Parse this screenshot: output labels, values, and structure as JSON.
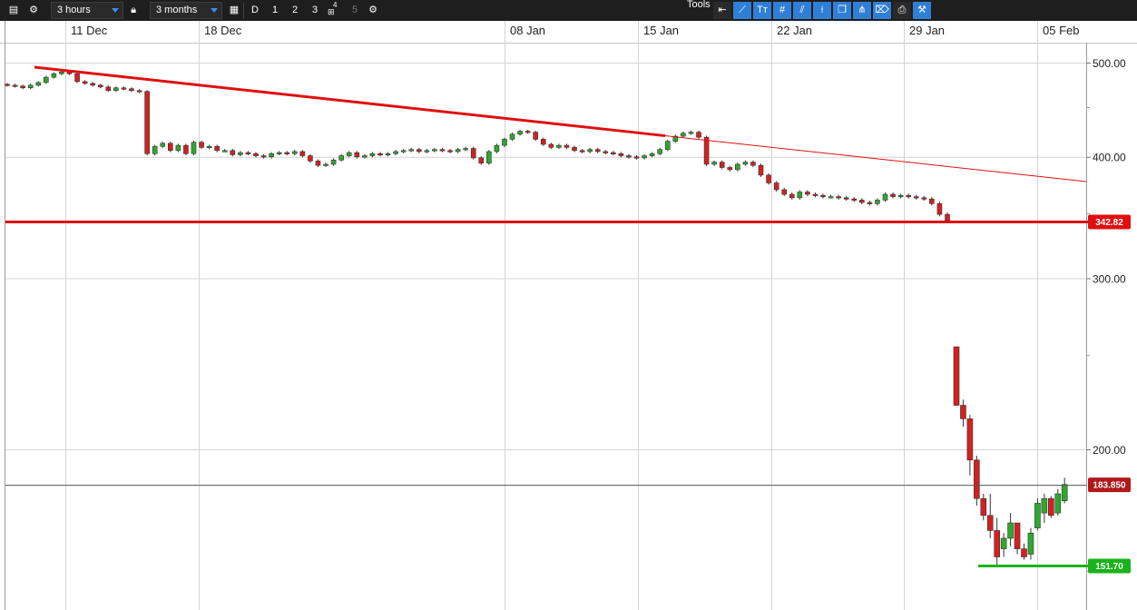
{
  "toolbar": {
    "interval": "3 hours",
    "range": "3 months",
    "period_buttons": [
      "D",
      "1",
      "2",
      "3",
      "4",
      "5"
    ],
    "tools_label": "Tools"
  },
  "colors": {
    "up": "#2ea82e",
    "down": "#d42020",
    "trendline": "#e01010",
    "support": "#1bb31b",
    "current_price_badge": "#b01818",
    "grid": "#d4d4d4",
    "tool_active": "#2f7fd6"
  },
  "chart_data": {
    "type": "candlestick",
    "xlabel": "",
    "ylabel": "",
    "x_ticks": [
      "11 Dec",
      "18 Dec",
      "08 Jan",
      "15 Jan",
      "22 Jan",
      "29 Jan",
      "05 Feb"
    ],
    "y_ticks": [
      500,
      400,
      300,
      200
    ],
    "y_tick_labels": [
      "500.00",
      "400.00",
      "300.00",
      "200.00"
    ],
    "y_scale": "log",
    "y_range": [
      138,
      530
    ],
    "grid": true,
    "closes": [
      474,
      473,
      471,
      474,
      477,
      483,
      487,
      489,
      487,
      478,
      476,
      474,
      472,
      468,
      471,
      470,
      468,
      467,
      403,
      410,
      413,
      406,
      411,
      403,
      414,
      409,
      410,
      406,
      406,
      402,
      404,
      403,
      401,
      400,
      403,
      404,
      403,
      405,
      401,
      396,
      392,
      393,
      397,
      401,
      404,
      400,
      401,
      403,
      402,
      403,
      405,
      406,
      407,
      405,
      406,
      407,
      406,
      405,
      407,
      408,
      399,
      394,
      405,
      411,
      417,
      422,
      425,
      424,
      417,
      412,
      409,
      411,
      409,
      406,
      405,
      407,
      405,
      404,
      403,
      401,
      400,
      399,
      401,
      403,
      407,
      415,
      420,
      423,
      424,
      419,
      393,
      395,
      390,
      388,
      393,
      395,
      392,
      383,
      376,
      370,
      366,
      363,
      368,
      366,
      365,
      364,
      364,
      363,
      362,
      361,
      359,
      358,
      361,
      366,
      364,
      365,
      364,
      363,
      362,
      358,
      349,
      344
    ],
    "tail_candles": [
      {
        "open": 255,
        "high": 255,
        "low": 222,
        "close": 222
      },
      {
        "open": 222,
        "high": 225,
        "low": 211,
        "close": 215
      },
      {
        "open": 215,
        "high": 217,
        "low": 188,
        "close": 195
      },
      {
        "open": 195,
        "high": 197,
        "low": 175,
        "close": 178
      },
      {
        "open": 178,
        "high": 180,
        "low": 169,
        "close": 171
      },
      {
        "open": 171,
        "high": 180,
        "low": 162,
        "close": 165
      },
      {
        "open": 165,
        "high": 170,
        "low": 151.7,
        "close": 155
      },
      {
        "open": 158,
        "high": 164,
        "low": 155,
        "close": 162
      },
      {
        "open": 162,
        "high": 172,
        "low": 159,
        "close": 168
      },
      {
        "open": 168,
        "high": 168,
        "low": 156,
        "close": 158
      },
      {
        "open": 158,
        "high": 160,
        "low": 154,
        "close": 155
      },
      {
        "open": 156,
        "high": 166,
        "low": 154,
        "close": 164
      },
      {
        "open": 166,
        "high": 178,
        "low": 165,
        "close": 176
      },
      {
        "open": 172,
        "high": 180,
        "low": 168,
        "close": 178
      },
      {
        "open": 178,
        "high": 179,
        "low": 170,
        "close": 171
      },
      {
        "open": 172,
        "high": 182,
        "low": 171,
        "close": 180
      },
      {
        "open": 177,
        "high": 187,
        "low": 176,
        "close": 184
      }
    ],
    "trendline": {
      "from": {
        "date": "07 Dec",
        "price": 490
      },
      "to": {
        "date": "07 Feb",
        "price": 370
      }
    },
    "support_line": {
      "price": 151.7,
      "label": "151.70"
    },
    "resistance_line": {
      "price": 342.82,
      "label": "342.82"
    },
    "last_price": {
      "price": 183.85,
      "label": "183.850"
    }
  }
}
